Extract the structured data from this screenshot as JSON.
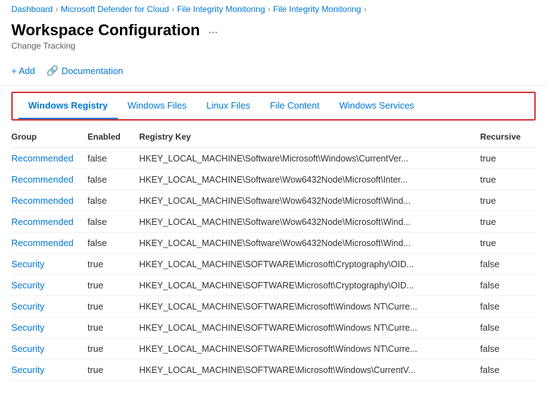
{
  "breadcrumb": {
    "items": [
      {
        "label": "Dashboard",
        "link": true
      },
      {
        "label": "Microsoft Defender for Cloud",
        "link": true
      },
      {
        "label": "File Integrity Monitoring",
        "link": true
      },
      {
        "label": "File Integrity Monitoring",
        "link": true
      }
    ]
  },
  "header": {
    "title": "Workspace Configuration",
    "ellipsis": "...",
    "subtitle": "Change Tracking"
  },
  "toolbar": {
    "add_label": "+ Add",
    "docs_label": "Documentation"
  },
  "tabs": [
    {
      "id": "windows-registry",
      "label": "Windows Registry",
      "active": true
    },
    {
      "id": "windows-files",
      "label": "Windows Files",
      "active": false
    },
    {
      "id": "linux-files",
      "label": "Linux Files",
      "active": false
    },
    {
      "id": "file-content",
      "label": "File Content",
      "active": false
    },
    {
      "id": "windows-services",
      "label": "Windows Services",
      "active": false
    }
  ],
  "table": {
    "columns": [
      {
        "id": "group",
        "label": "Group"
      },
      {
        "id": "enabled",
        "label": "Enabled"
      },
      {
        "id": "registry_key",
        "label": "Registry Key"
      },
      {
        "id": "recursive",
        "label": "Recursive"
      }
    ],
    "rows": [
      {
        "group": "Recommended",
        "enabled": "false",
        "registry_key": "HKEY_LOCAL_MACHINE\\Software\\Microsoft\\Windows\\CurrentVer...",
        "recursive": "true"
      },
      {
        "group": "Recommended",
        "enabled": "false",
        "registry_key": "HKEY_LOCAL_MACHINE\\Software\\Wow6432Node\\Microsoft\\Inter...",
        "recursive": "true"
      },
      {
        "group": "Recommended",
        "enabled": "false",
        "registry_key": "HKEY_LOCAL_MACHINE\\Software\\Wow6432Node\\Microsoft\\Wind...",
        "recursive": "true"
      },
      {
        "group": "Recommended",
        "enabled": "false",
        "registry_key": "HKEY_LOCAL_MACHINE\\Software\\Wow6432Node\\Microsoft\\Wind...",
        "recursive": "true"
      },
      {
        "group": "Recommended",
        "enabled": "false",
        "registry_key": "HKEY_LOCAL_MACHINE\\Software\\Wow6432Node\\Microsoft\\Wind...",
        "recursive": "true"
      },
      {
        "group": "Security",
        "enabled": "true",
        "registry_key": "HKEY_LOCAL_MACHINE\\SOFTWARE\\Microsoft\\Cryptography\\OID...",
        "recursive": "false"
      },
      {
        "group": "Security",
        "enabled": "true",
        "registry_key": "HKEY_LOCAL_MACHINE\\SOFTWARE\\Microsoft\\Cryptography\\OID...",
        "recursive": "false"
      },
      {
        "group": "Security",
        "enabled": "true",
        "registry_key": "HKEY_LOCAL_MACHINE\\SOFTWARE\\Microsoft\\Windows NT\\Curre...",
        "recursive": "false"
      },
      {
        "group": "Security",
        "enabled": "true",
        "registry_key": "HKEY_LOCAL_MACHINE\\SOFTWARE\\Microsoft\\Windows NT\\Curre...",
        "recursive": "false"
      },
      {
        "group": "Security",
        "enabled": "true",
        "registry_key": "HKEY_LOCAL_MACHINE\\SOFTWARE\\Microsoft\\Windows NT\\Curre...",
        "recursive": "false"
      },
      {
        "group": "Security",
        "enabled": "true",
        "registry_key": "HKEY_LOCAL_MACHINE\\SOFTWARE\\Microsoft\\Windows\\CurrentV...",
        "recursive": "false"
      }
    ]
  }
}
